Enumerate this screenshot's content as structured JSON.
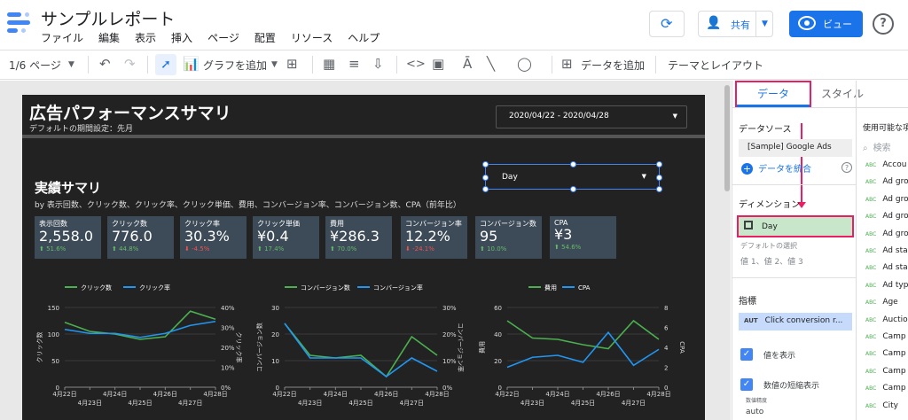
{
  "app": {
    "title": "サンプルレポート",
    "menus": [
      "ファイル",
      "編集",
      "表示",
      "挿入",
      "ページ",
      "配置",
      "リソース",
      "ヘルプ"
    ],
    "share_label": "共有",
    "view_label": "ビュー",
    "help_label": "?"
  },
  "toolbar": {
    "page_label": "1/6 ページ",
    "add_chart": "グラフを追加",
    "add_data": "データを追加",
    "theme": "テーマとレイアウト"
  },
  "report": {
    "title": "広告パフォーマンスサマリ",
    "subtitle": "デフォルトの期間設定：先月",
    "date_range": "2020/04/22 - 2020/04/28",
    "day_control": "Day",
    "section_title": "実績サマリ",
    "section_sub": "by 表示回数、クリック数、クリック率、クリック単価、費用、コンバージョン率、コンバージョン数、CPA（前年比）"
  },
  "kpis": [
    {
      "label": "表示回数",
      "value": "2,558.0",
      "delta": "51.6%",
      "dir": "up"
    },
    {
      "label": "クリック数",
      "value": "776.0",
      "delta": "44.8%",
      "dir": "up"
    },
    {
      "label": "クリック率",
      "value": "30.3%",
      "delta": "-4.5%",
      "dir": "down"
    },
    {
      "label": "クリック単価",
      "value": "¥0.4",
      "delta": "17.4%",
      "dir": "up"
    },
    {
      "label": "費用",
      "value": "¥286.3",
      "delta": "70.0%",
      "dir": "up"
    },
    {
      "label": "コンバージョン率",
      "value": "12.2%",
      "delta": "-24.1%",
      "dir": "down"
    },
    {
      "label": "コンバージョン数",
      "value": "95",
      "delta": "10.0%",
      "dir": "up"
    },
    {
      "label": "CPA",
      "value": "¥3",
      "delta": "54.6%",
      "dir": "up"
    }
  ],
  "chart_data": [
    {
      "type": "line",
      "x": [
        "4月22日",
        "4月23日",
        "4月24日",
        "4月25日",
        "4月26日",
        "4月27日",
        "4月28日"
      ],
      "series": [
        {
          "name": "クリック数",
          "axis": "left",
          "color": "#4caf50",
          "values": [
            122,
            105,
            100,
            90,
            95,
            143,
            128
          ]
        },
        {
          "name": "クリック率",
          "axis": "right",
          "color": "#2196f3",
          "values": [
            29,
            27,
            27,
            25,
            27,
            31,
            33
          ]
        }
      ],
      "ylabel": "クリック数",
      "ylabel_right": "クリック率",
      "ylim": [
        0,
        150
      ],
      "yticks": [
        "0",
        "50",
        "100",
        "150"
      ],
      "ylim_right": [
        0,
        40
      ],
      "yticks_right": [
        "0%",
        "10%",
        "20%",
        "30%",
        "40%"
      ]
    },
    {
      "type": "line",
      "x": [
        "4月22日",
        "4月23日",
        "4月24日",
        "4月25日",
        "4月26日",
        "4月27日",
        "4月28日"
      ],
      "series": [
        {
          "name": "コンバージョン数",
          "axis": "left",
          "color": "#4caf50",
          "values": [
            24,
            12,
            11,
            12,
            4,
            19,
            12
          ]
        },
        {
          "name": "コンバージョン率",
          "axis": "right",
          "color": "#2196f3",
          "values": [
            24,
            11,
            11,
            11,
            4,
            11,
            6
          ]
        }
      ],
      "ylabel": "コンバージョン数",
      "ylabel_right": "コンバージョン率",
      "ylim": [
        0,
        30
      ],
      "yticks": [
        "0",
        "10",
        "20",
        "30"
      ],
      "ylim_right": [
        0,
        30
      ],
      "yticks_right": [
        "0%",
        "10%",
        "20%",
        "30%"
      ]
    },
    {
      "type": "line",
      "x": [
        "4月22日",
        "4月23日",
        "4月24日",
        "4月25日",
        "4月26日",
        "4月27日",
        "4月28日"
      ],
      "series": [
        {
          "name": "費用",
          "axis": "left",
          "color": "#4caf50",
          "values": [
            50,
            37,
            36,
            32,
            29,
            50,
            36
          ]
        },
        {
          "name": "CPA",
          "axis": "right",
          "color": "#2196f3",
          "values": [
            2,
            3,
            3.2,
            2.5,
            5.5,
            2.2,
            3.8
          ]
        }
      ],
      "ylabel": "費用",
      "ylabel_right": "CPA",
      "ylim": [
        0,
        60
      ],
      "yticks": [
        "0",
        "20",
        "40",
        "60"
      ],
      "ylim_right": [
        0,
        8
      ],
      "yticks_right": [
        "0",
        "2",
        "4",
        "6",
        "8"
      ]
    }
  ],
  "panel": {
    "tab_data": "データ",
    "tab_style": "スタイル",
    "datasource_head": "データソース",
    "datasource": "[Sample] Google Ads",
    "blend": "データを統合",
    "dimension_head": "ディメンション",
    "dimension": "Day",
    "default_sel": "デフォルトの選択",
    "default_vals": "値 1、値 2、値 3",
    "metric_head": "指標",
    "metric_type": "AUT",
    "metric": "Click conversion r...",
    "show_values": "値を表示",
    "compact": "数値の短縮表示",
    "precision": "数値精度",
    "precision_val": "auto",
    "fields_head": "使用可能な項目",
    "search": "検索",
    "field_type": "ABC",
    "fields": [
      "Accou",
      "Ad gro",
      "Ad gro",
      "Ad gro",
      "Ad gro",
      "Ad sta",
      "Ad sta",
      "Ad typ",
      "Age",
      "Auctio",
      "Camp",
      "Camp",
      "Camp",
      "Camp",
      "City"
    ]
  }
}
